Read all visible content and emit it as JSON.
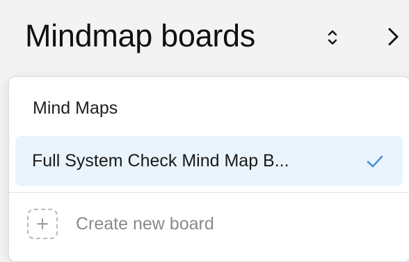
{
  "header": {
    "title": "Mindmap boards",
    "sort_icon": "chevron-up-down-icon",
    "next_icon": "chevron-right-icon"
  },
  "dropdown": {
    "section_label": "Mind Maps",
    "items": [
      {
        "label": "Full System Check Mind Map B...",
        "selected": true,
        "selected_icon": "check-icon"
      }
    ],
    "create": {
      "label": "Create new board",
      "icon": "plus-icon"
    }
  },
  "colors": {
    "selected_background": "#eaf4fd",
    "check_color": "#4a90d9",
    "muted_text": "#8a8a8a"
  }
}
